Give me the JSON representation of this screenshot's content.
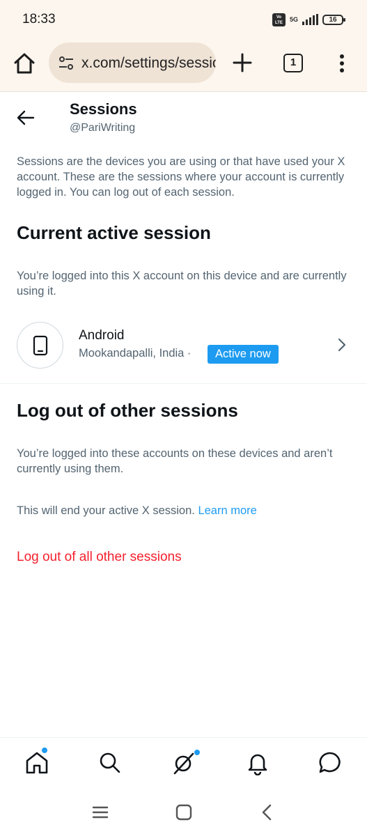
{
  "status_bar": {
    "time": "18:33",
    "volte_label": "Vo LTE",
    "network": "5G",
    "battery": "16"
  },
  "browser": {
    "url": "x.com/settings/sessions",
    "tab_count": "1"
  },
  "header": {
    "title": "Sessions",
    "handle": "@PariWriting"
  },
  "intro": "Sessions are the devices you are using or that have used your X account. These are the sessions where your account is currently logged in. You can log out of each session.",
  "current_session": {
    "title": "Current active session",
    "description": "You’re logged into this X account on this device and are currently using it.",
    "device": "Android",
    "location": "Mookandapalli, India ·",
    "badge": "Active now"
  },
  "other_sessions": {
    "title": "Log out of other sessions",
    "description": "You’re logged into these accounts on these devices and aren’t currently using them.",
    "note": "This will end your active X session.",
    "learn_more": "Learn more",
    "logout_all": "Log out of all other sessions"
  },
  "colors": {
    "accent": "#1d9bf0",
    "danger": "#f4212e",
    "browser_bg": "#fdf6ee"
  }
}
